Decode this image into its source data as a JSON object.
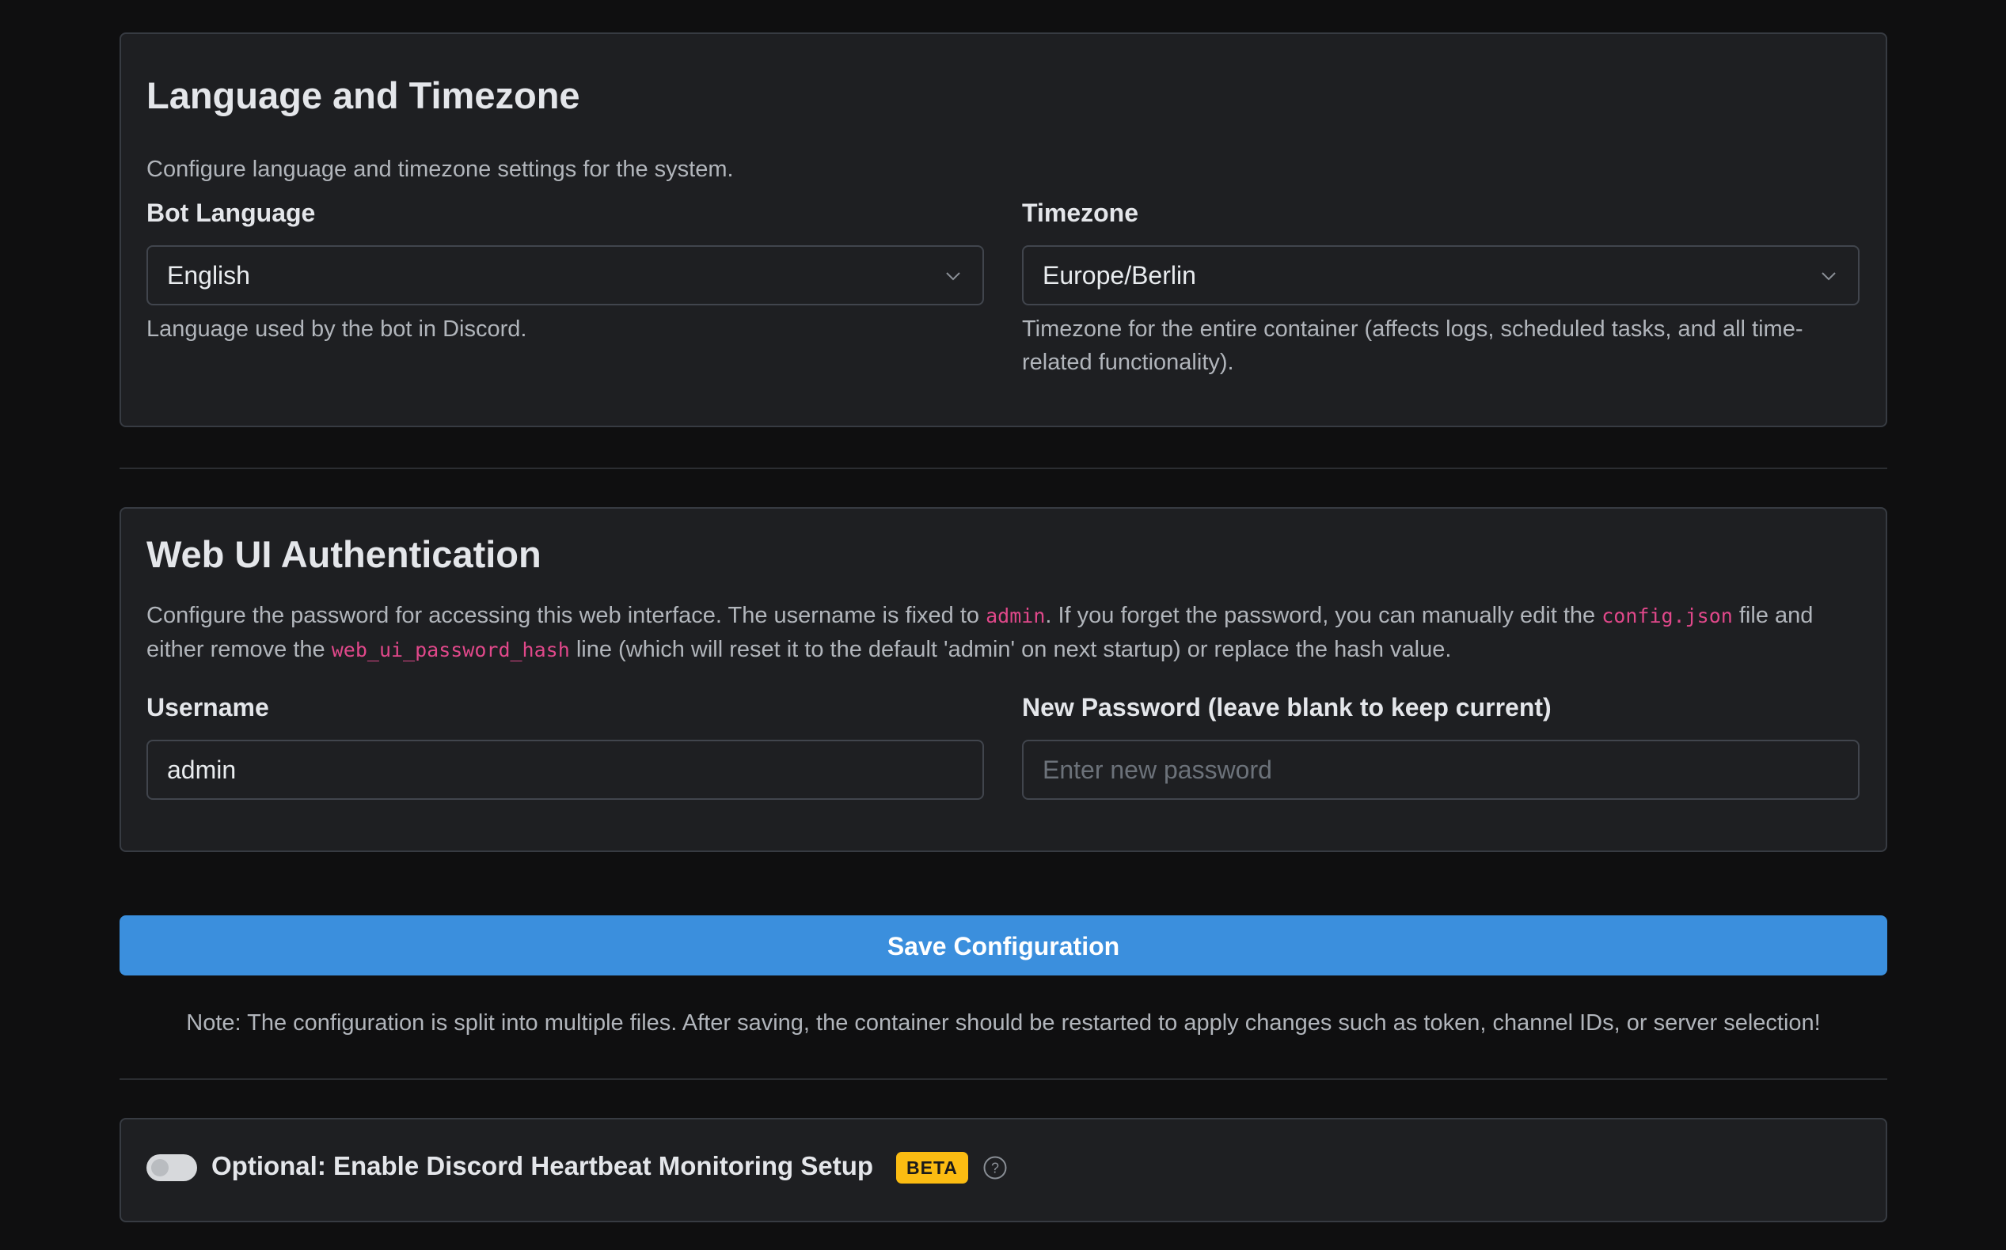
{
  "language_timezone": {
    "title": "Language and Timezone",
    "description": "Configure language and timezone settings for the system.",
    "bot_language": {
      "label": "Bot Language",
      "value": "English",
      "help": "Language used by the bot in Discord."
    },
    "timezone": {
      "label": "Timezone",
      "value": "Europe/Berlin",
      "help_line1": "Timezone for the entire container (affects logs, scheduled tasks, and all time-",
      "help_line2": "related functionality)."
    }
  },
  "web_ui_auth": {
    "title": "Web UI Authentication",
    "description": {
      "part1": "Configure the password for accessing this web interface. The username is fixed to ",
      "code1": "admin",
      "part2": ". If you forget the password, you can manually edit the ",
      "code2": "config.json",
      "part3": " file and",
      "part4": "either remove the ",
      "code3": "web_ui_password_hash",
      "part5": " line (which will reset it to the default 'admin' on next startup) or replace the hash value."
    },
    "username": {
      "label": "Username",
      "value": "admin"
    },
    "new_password": {
      "label": "New Password (leave blank to keep current)",
      "placeholder": "Enter new password"
    }
  },
  "save_button_label": "Save Configuration",
  "note": "Note: The configuration is split into multiple files. After saving, the container should be restarted to apply changes such as token, channel IDs, or server selection!",
  "heartbeat": {
    "label": "Optional: Enable Discord Heartbeat Monitoring Setup",
    "badge": "BETA",
    "enabled": false
  },
  "colors": {
    "background": "#0f0f10",
    "card": "#1e1f22",
    "accent": "#3b8fdd",
    "code": "#e0488a",
    "badge": "#fbbc12"
  }
}
